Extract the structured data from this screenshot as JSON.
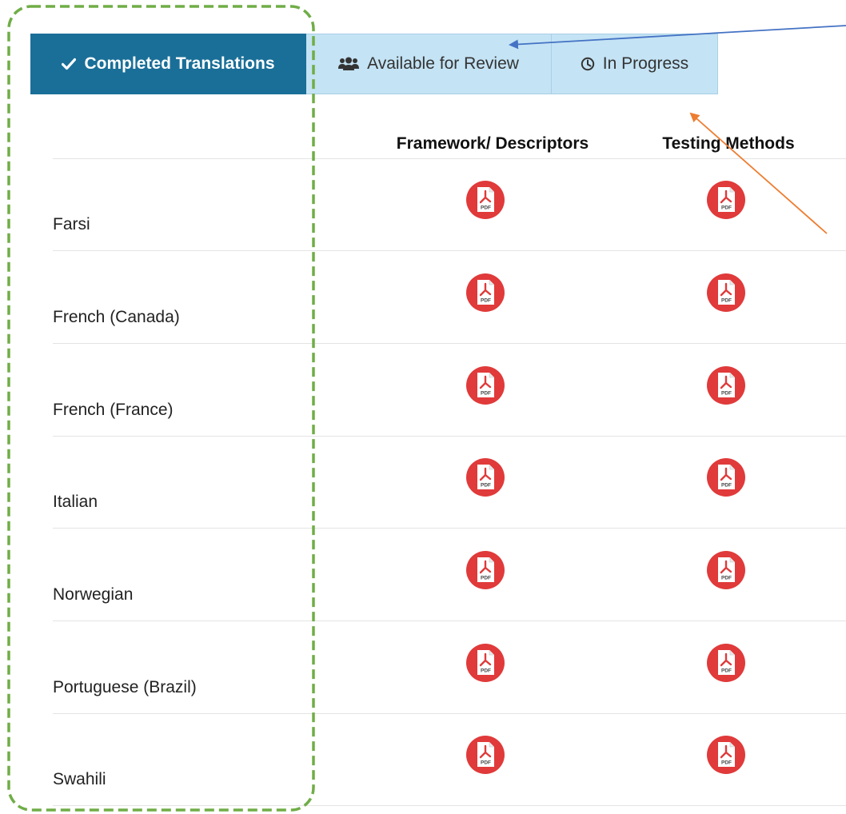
{
  "tabs": [
    {
      "label": "Completed Translations",
      "icon": "check-icon",
      "active": true
    },
    {
      "label": "Available for Review",
      "icon": "users-icon",
      "active": false
    },
    {
      "label": "In Progress",
      "icon": "clock-icon",
      "active": false
    }
  ],
  "table": {
    "columns": [
      "Framework/ Descriptors",
      "Testing Methods"
    ],
    "rows": [
      {
        "language": "Farsi"
      },
      {
        "language": "French (Canada)"
      },
      {
        "language": "French (France)"
      },
      {
        "language": "Italian"
      },
      {
        "language": "Norwegian"
      },
      {
        "language": "Portuguese (Brazil)"
      },
      {
        "language": "Swahili"
      }
    ],
    "cell_icon": "pdf-file-icon",
    "pdf_text": "PDF"
  },
  "colors": {
    "active_tab": "#1a6f98",
    "inactive_tab": "#c4e3f4",
    "pdf_red": "#e03a3a",
    "annotation_green": "#70ad47",
    "annotation_blue": "#4472c4",
    "annotation_orange": "#ed7d31"
  }
}
